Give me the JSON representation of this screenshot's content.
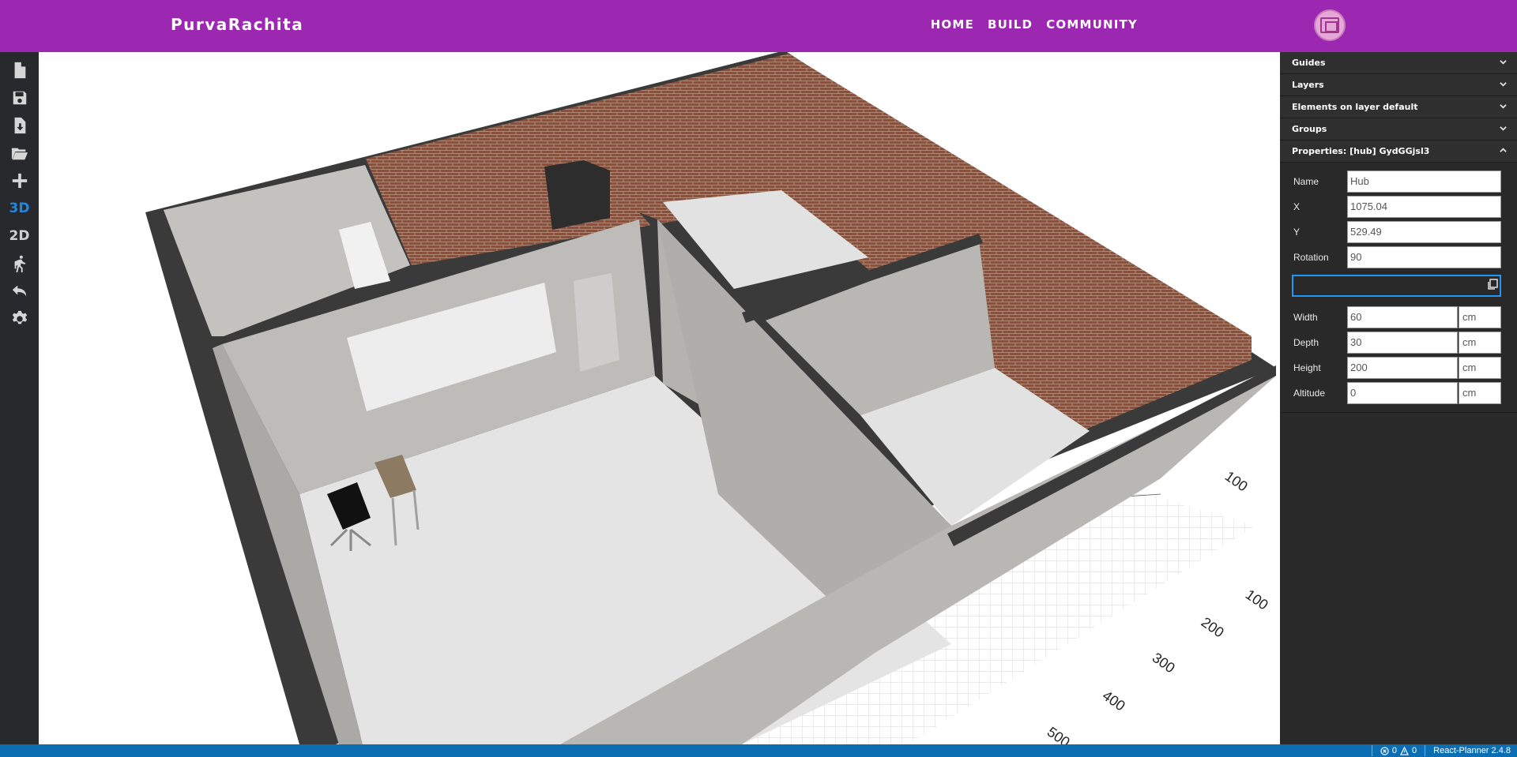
{
  "navbar": {
    "brand": "PurvaRachita",
    "links": [
      "HOME",
      "BUILD",
      "COMMUNITY"
    ]
  },
  "toolbar": {
    "tools": [
      {
        "icon": "new-file-icon"
      },
      {
        "icon": "save-icon"
      },
      {
        "icon": "save-as-icon"
      },
      {
        "icon": "open-folder-icon"
      },
      {
        "icon": "plus-icon"
      },
      {
        "label": "3D",
        "active": true
      },
      {
        "label": "2D"
      },
      {
        "icon": "walk-icon"
      },
      {
        "icon": "undo-icon"
      },
      {
        "icon": "settings-icon"
      }
    ]
  },
  "panel": {
    "sections": [
      {
        "title": "Guides",
        "expanded": false
      },
      {
        "title": "Layers",
        "expanded": false
      },
      {
        "title": "Elements on layer default",
        "expanded": false
      },
      {
        "title": "Groups",
        "expanded": false
      },
      {
        "title": "Properties: [hub] GydGGjsl3",
        "expanded": true
      }
    ],
    "properties": {
      "name": {
        "label": "Name",
        "value": "Hub"
      },
      "x": {
        "label": "X",
        "value": "1075.04"
      },
      "y": {
        "label": "Y",
        "value": "529.49"
      },
      "rotation": {
        "label": "Rotation",
        "value": "90"
      },
      "width": {
        "label": "Width",
        "value": "60",
        "unit": "cm"
      },
      "depth": {
        "label": "Depth",
        "value": "30",
        "unit": "cm"
      },
      "height": {
        "label": "Height",
        "value": "200",
        "unit": "cm"
      },
      "altitude": {
        "label": "Altitude",
        "value": "0",
        "unit": "cm"
      }
    }
  },
  "viewport": {
    "ruler_labels": [
      "100",
      "100",
      "200",
      "300",
      "400",
      "500"
    ]
  },
  "statusbar": {
    "errors": "0",
    "warnings": "0",
    "version": "React-Planner 2.4.8"
  },
  "colors": {
    "navbar": "#9c27b0",
    "toolbar": "#28292d",
    "panel": "#292929",
    "statusbar": "#0b6eb3",
    "active_tool": "#1e88e5"
  }
}
